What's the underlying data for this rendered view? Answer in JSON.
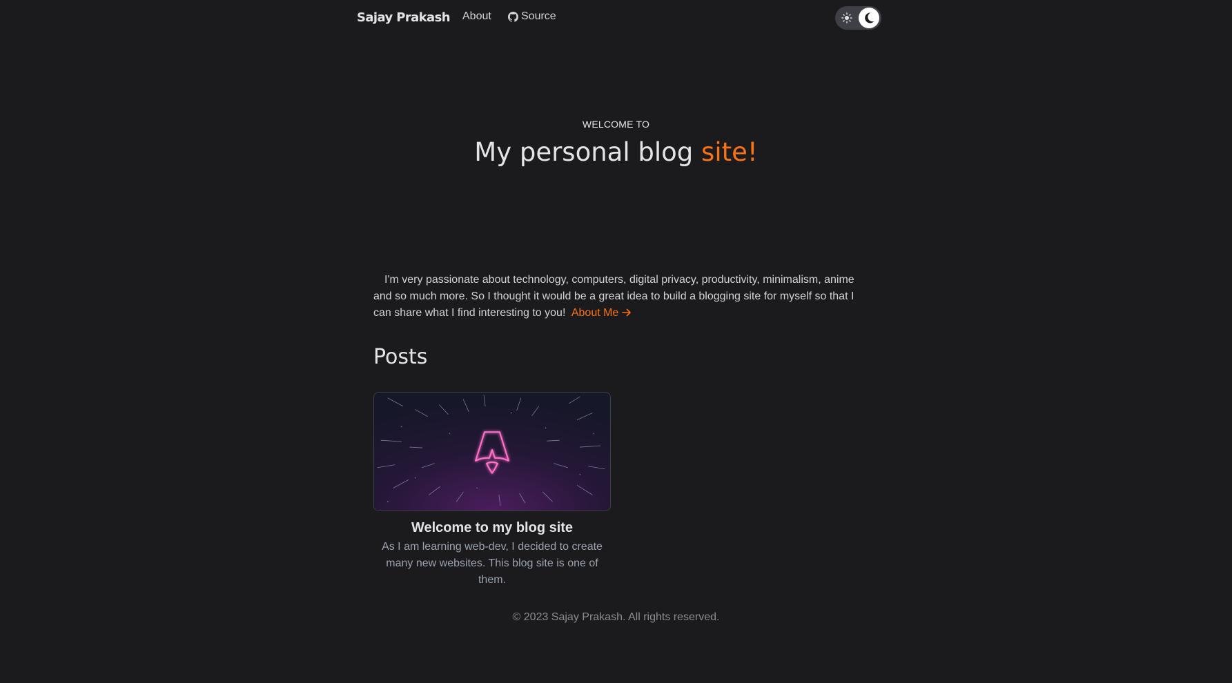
{
  "nav": {
    "brand": "Sajay Prakash",
    "links": [
      {
        "label": "About"
      },
      {
        "label": "Source",
        "icon": "github-icon"
      }
    ],
    "theme_toggle": {
      "state": "dark",
      "icons": [
        "sun-icon",
        "moon-icon"
      ]
    }
  },
  "hero": {
    "eyebrow": "WELCOME TO",
    "title_main": "My personal blog ",
    "title_accent": "site!"
  },
  "intro": {
    "text": "I'm very passionate about technology, computers, digital privacy, productivity, minimalism, anime and so much more. So I thought it would be a great idea to build a blogging site for myself so that I can share what I find interesting to you!",
    "link_label": "About Me"
  },
  "posts": {
    "heading": "Posts",
    "items": [
      {
        "title": "Welcome to my blog site",
        "description": "As I am learning web-dev, I decided to create many new websites. This blog site is one of them.",
        "image": "astro-rocket-neon-image"
      }
    ]
  },
  "footer": {
    "text": "© 2023 Sajay Prakash. All rights reserved."
  },
  "colors": {
    "background": "#1b1b1d",
    "accent": "#f97316",
    "text": "#d4d4d8",
    "muted": "#9ca3af"
  }
}
